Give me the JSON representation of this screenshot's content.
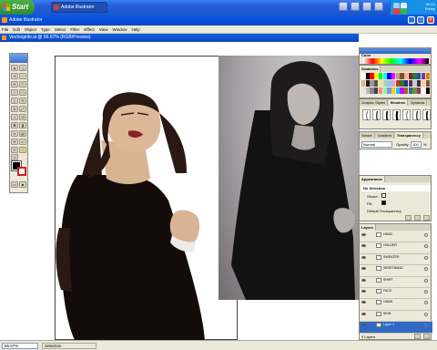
{
  "taskbar": {
    "start_label": "Start",
    "task_label": "Adobe Illustrator",
    "clock_time": "00:10",
    "clock_day": "Friday",
    "tray_icons": [
      "network-icon",
      "volume-icon",
      "security-icon",
      "messenger-icon"
    ]
  },
  "app": {
    "title": "Adobe Illustrator",
    "menu": [
      "File",
      "Edit",
      "Object",
      "Type",
      "Select",
      "Filter",
      "Effect",
      "View",
      "Window",
      "Help"
    ]
  },
  "document": {
    "title": "Vectorgirile.ai @ 66.67% (RGB/Preview)"
  },
  "status": {
    "zoom": "66.67%",
    "tool": "Selection"
  },
  "panels": {
    "color": {
      "tab": "Color"
    },
    "swatches": {
      "tab": "Swatches"
    },
    "brushes": {
      "tabs": [
        "Graphic Styles",
        "Brushes",
        "Symbols"
      ]
    },
    "stroke": {
      "tabs": [
        "Stroke",
        "Gradient",
        "Transparency"
      ],
      "blend_mode": "Normal",
      "opacity_label": "Opacity:",
      "opacity_value": "100",
      "opacity_unit": "%"
    },
    "appearance": {
      "tab": "Appearance",
      "selection": "No Selection",
      "stroke_label": "Stroke:",
      "fill_label": "Fill:",
      "transparency": "Default Transparency"
    },
    "layers": {
      "tab": "Layers",
      "rows": [
        "HEAD",
        "HOLDER",
        "SWEATER",
        "WRISTBAND",
        "SHIRT",
        "FACE",
        "HAND",
        "SKIN",
        "Layer 1"
      ],
      "selected_row": "Layer 1",
      "count": "9 Layers"
    }
  },
  "colors": {
    "taskbar": "#245edb",
    "start": "#3a9a36",
    "title": "#0a58e6",
    "selection": "#316ac5",
    "skin": "#d9b494",
    "hair": "#2a1812",
    "shirt": "#130c0a"
  }
}
